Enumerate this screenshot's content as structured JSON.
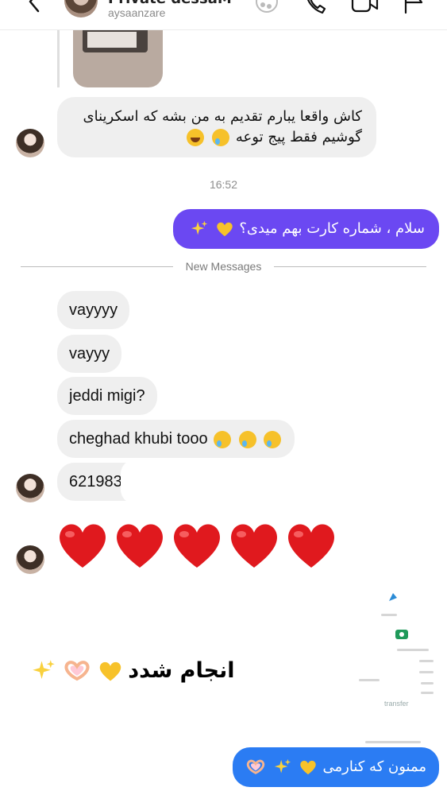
{
  "header": {
    "title": "Private dessaM",
    "username": "aysaanzare",
    "icons": [
      "back-icon",
      "theme-icon",
      "call-icon",
      "video-icon",
      "flag-icon"
    ]
  },
  "messages": {
    "quoted_reply": "کاش واقعا یبارم تقدیم به من بشه که اسکرینای گوشیم فقط پیج توعه",
    "quoted_line1": "کاش واقعا یبارم تقدیم به من بشه که اسکرینای",
    "quoted_line2": "گوشیم فقط پیج توعه",
    "time": "16:52",
    "outgoing_card": "سلام ، شماره کارت بهم میدی؟",
    "new_messages": "New Messages",
    "incoming": [
      {
        "text": "vayyyy"
      },
      {
        "text": "vayyy"
      },
      {
        "text": "jeddi migi?"
      },
      {
        "text": "cheghad khubi tooo"
      },
      {
        "text": "621983"
      }
    ],
    "hearts_count": 5,
    "done_text": "انجام شدد",
    "thanks_text": "ممنون که کنارمی",
    "receipt_word": "transfer"
  },
  "colors": {
    "outgoing_bubble": "#6b48f2",
    "incoming_bubble": "#efefef",
    "heart_red": "#e0191e",
    "heart_yellow": "#f7c22a",
    "thanks_bubble": "#2b7cf3"
  }
}
